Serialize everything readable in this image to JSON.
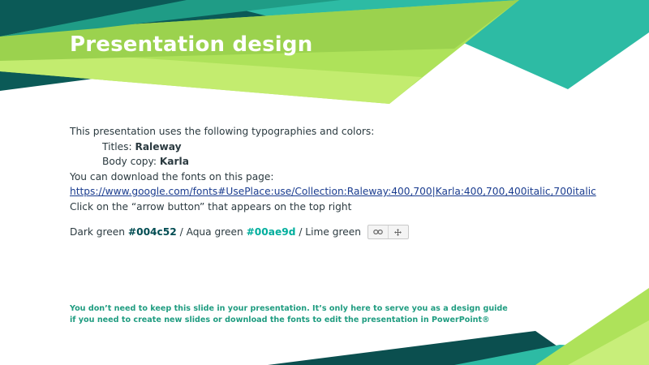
{
  "slide": {
    "title": "Presentation design",
    "intro": "This presentation uses the following typographies and colors:",
    "titles_label": "Titles: ",
    "titles_font": "Raleway",
    "body_label": "Body copy: ",
    "body_font": "Karla",
    "download_text": "You can download the fonts on this page:",
    "fonts_link": "https://www.google.com/fonts#UsePlace:use/Collection:Raleway:400,700|Karla:400,700,400italic,700italic",
    "arrow_text": "Click on the “arrow button” that appears on the top right",
    "colors": {
      "dark_label": "Dark green ",
      "dark_hex": "#004c52",
      "sep1": " / Aqua green ",
      "aqua_hex": "#00ae9d",
      "sep2": " / Lime green"
    },
    "toolbar_icons": [
      "link-icon",
      "move-icon"
    ],
    "footnote_line1": "You don’t need to keep this slide in your presentation. It’s only here to serve you as a design guide",
    "footnote_line2": "if you need to create new slides or download the fonts to edit the presentation in PowerPoint®"
  },
  "palette": {
    "dark_green": "#004c52",
    "aqua_green": "#00ae9d",
    "lime_green": "#b7e65a",
    "teal": "#2fbfa6"
  }
}
